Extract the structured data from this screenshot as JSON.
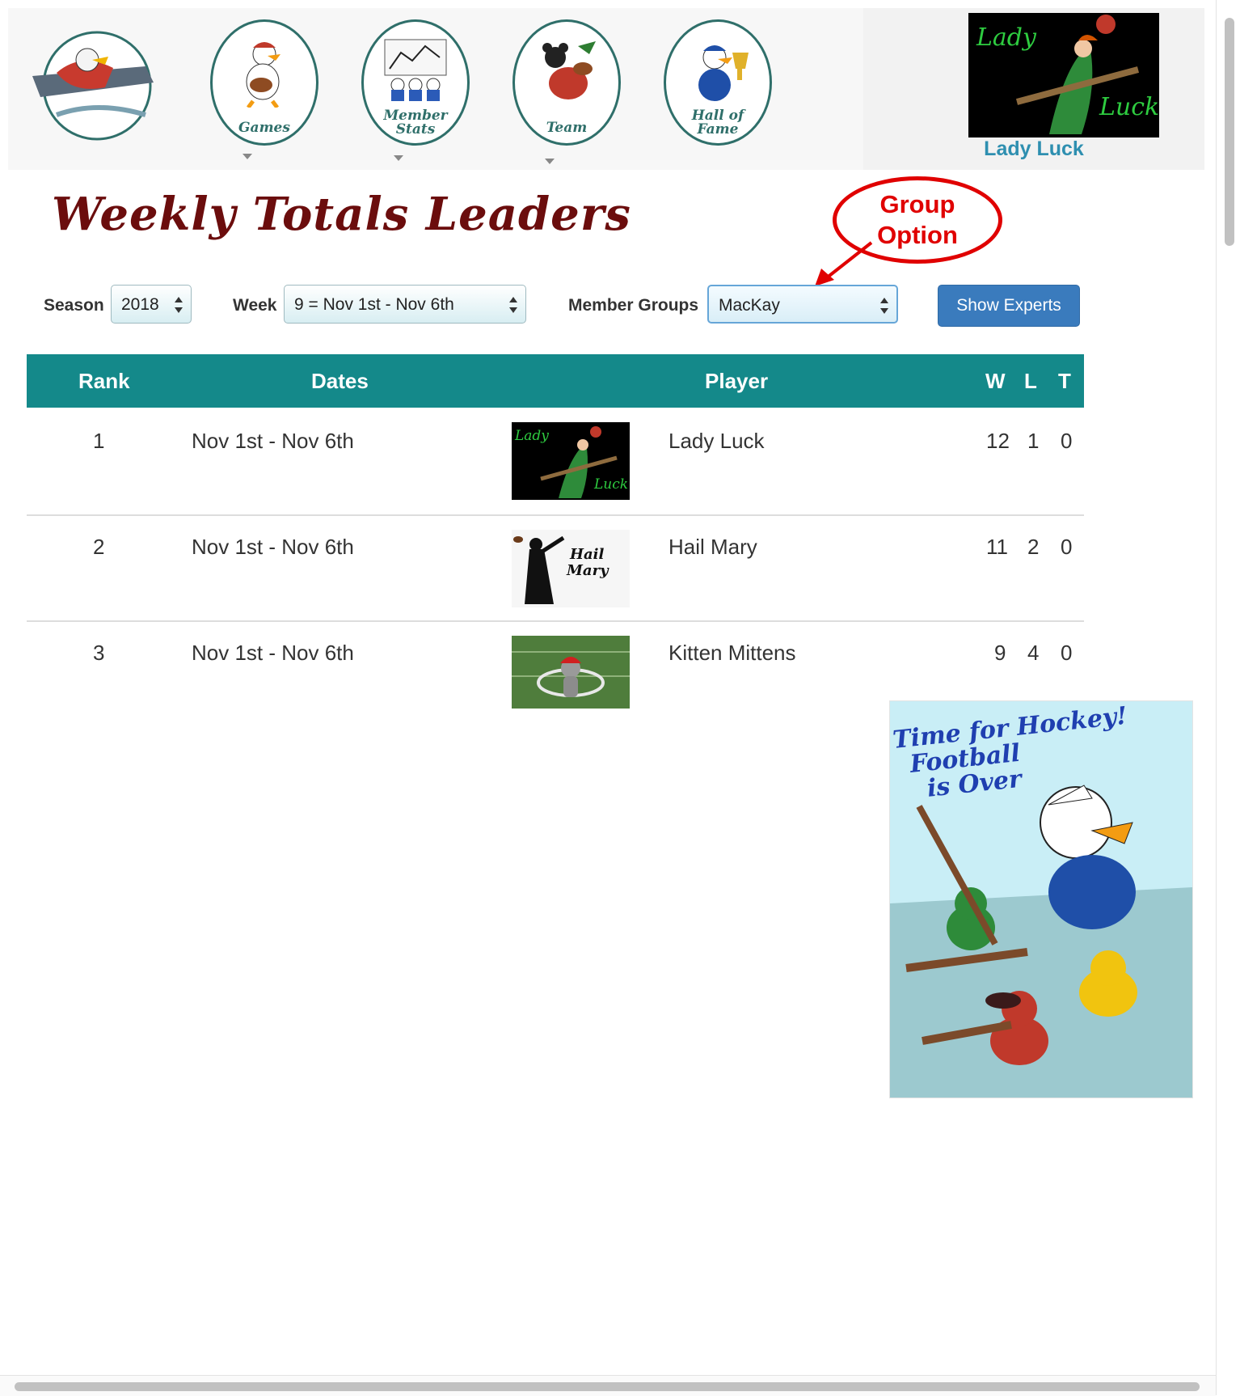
{
  "nav": {
    "items": [
      {
        "name": "home-logo",
        "caption": ""
      },
      {
        "name": "games",
        "caption": "Games"
      },
      {
        "name": "member-stats",
        "caption_line1": "Member",
        "caption_line2": "Stats"
      },
      {
        "name": "team",
        "caption": "Team"
      },
      {
        "name": "hall-of-fame",
        "caption_line1": "Hall of",
        "caption_line2": "Fame"
      }
    ],
    "profile": {
      "image_text_1": "Lady",
      "image_text_2": "Luck",
      "name": "Lady Luck"
    }
  },
  "page": {
    "title": "Weekly Totals Leaders"
  },
  "annotation": {
    "line1": "Group",
    "line2": "Option"
  },
  "filters": {
    "season_label": "Season",
    "season_value": "2018",
    "week_label": "Week",
    "week_value": "9 = Nov 1st - Nov 6th",
    "groups_label": "Member Groups",
    "groups_value": "MacKay",
    "show_experts_label": "Show Experts"
  },
  "table": {
    "headers": {
      "rank": "Rank",
      "dates": "Dates",
      "player": "Player",
      "w": "W",
      "l": "L",
      "t": "T"
    },
    "rows": [
      {
        "rank": "1",
        "dates": "Nov 1st - Nov 6th",
        "player": "Lady Luck",
        "w": "12",
        "l": "1",
        "t": "0",
        "avatar": "lady-luck-avatar"
      },
      {
        "rank": "2",
        "dates": "Nov 1st - Nov 6th",
        "player": "Hail Mary",
        "w": "11",
        "l": "2",
        "t": "0",
        "avatar": "hail-mary-avatar",
        "avatar_text_1": "Hail",
        "avatar_text_2": "Mary"
      },
      {
        "rank": "3",
        "dates": "Nov 1st - Nov 6th",
        "player": "Kitten Mittens",
        "w": "9",
        "l": "4",
        "t": "0",
        "avatar": "kitten-mittens-avatar"
      }
    ]
  },
  "promo": {
    "line1": "Time for Hockey!",
    "line2": "Football",
    "line3": "is Over"
  },
  "colors": {
    "table_header": "#14898a",
    "title": "#6b0d0d",
    "button": "#3a7bbd",
    "callout": "#e00000",
    "profile_name": "#2e8fb0"
  }
}
